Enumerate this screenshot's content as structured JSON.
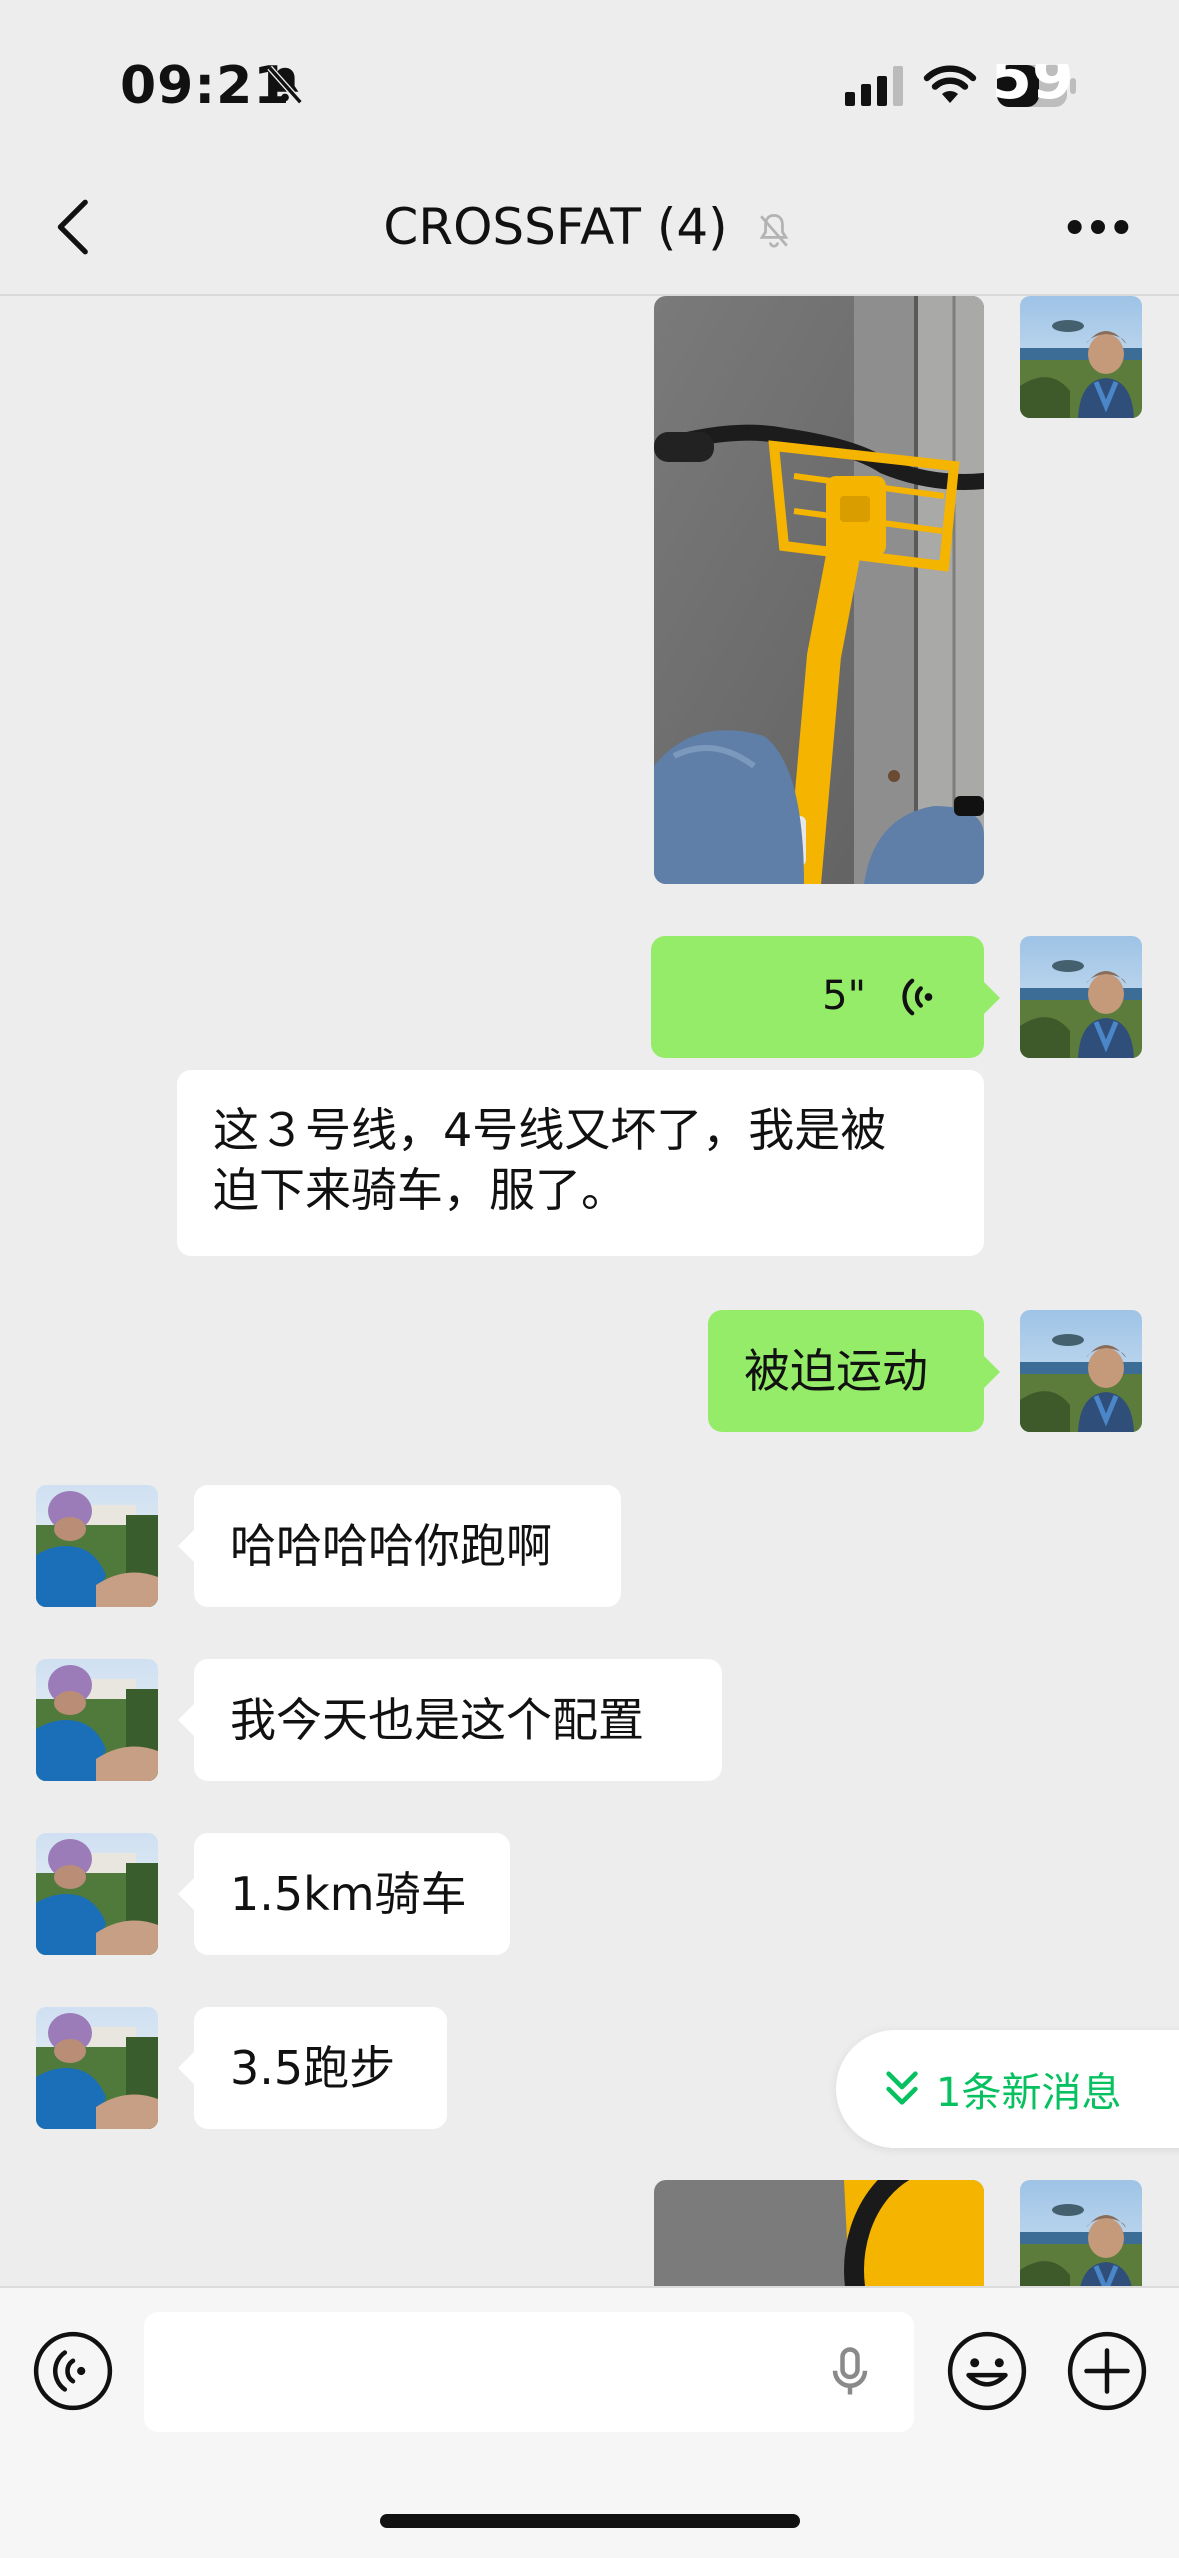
{
  "status": {
    "time": "09:21",
    "battery": "59"
  },
  "header": {
    "title": "CROSSFAT (4)"
  },
  "messages": [
    {
      "type": "image",
      "side": "right",
      "image": "yellow-shared-bike-photo"
    },
    {
      "type": "voice",
      "side": "right",
      "duration": "5\""
    },
    {
      "type": "text",
      "side": "left",
      "text_line1": "这３号线，4号线又坏了，我是被",
      "text_line2": "迫下来骑车，服了。"
    },
    {
      "type": "text",
      "side": "right",
      "text": "被迫运动"
    },
    {
      "type": "text",
      "side": "left",
      "text": "哈哈哈哈你跑啊"
    },
    {
      "type": "text",
      "side": "left",
      "text": "我今天也是这个配置"
    },
    {
      "type": "text",
      "side": "left",
      "text": "1.5km骑车"
    },
    {
      "type": "text",
      "side": "left",
      "text": "3.5跑步"
    },
    {
      "type": "image",
      "side": "right",
      "image": "bike-wheel-photo-partial"
    }
  ],
  "new_message_banner": "1条新消息",
  "input": {
    "placeholder": ""
  },
  "icons": {
    "back": "chevron-left-icon",
    "more": "more-dots-icon",
    "voice": "voice-toggle-icon",
    "mic": "microphone-icon",
    "emoji": "emoji-icon",
    "plus": "plus-circle-icon"
  },
  "colors": {
    "background": "#ededed",
    "self_bubble": "#95ec69",
    "other_bubble": "#ffffff",
    "accent": "#07c160"
  }
}
